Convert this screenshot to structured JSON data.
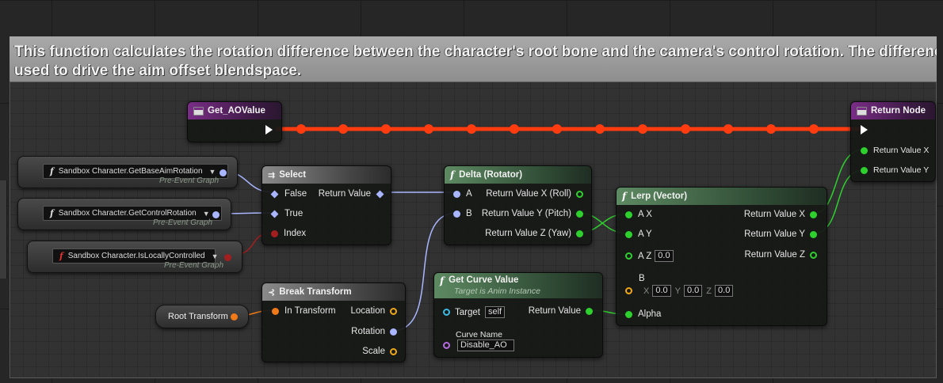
{
  "comment": {
    "line1": "This function calculates the rotation difference between the character's root bone and the camera's control rotation. The difference is",
    "line2": "used to drive the aim offset blendspace."
  },
  "nodes": {
    "get_ao": {
      "title": "Get_AOValue"
    },
    "return_node": {
      "title": "Return Node",
      "pins": [
        "Return Value X",
        "Return Value Y"
      ]
    },
    "select": {
      "title": "Select",
      "pins": {
        "false": "False",
        "true": "True",
        "index": "Index",
        "return": "Return Value"
      }
    },
    "delta": {
      "title": "Delta (Rotator)",
      "pins": {
        "a": "A",
        "b": "B",
        "roll": "Return Value X (Roll)",
        "pitch": "Return Value Y (Pitch)",
        "yaw": "Return Value Z (Yaw)"
      }
    },
    "lerp": {
      "title": "Lerp (Vector)",
      "pins": {
        "ax": "A X",
        "ay": "A Y",
        "az": "A Z",
        "az_value": "0.0",
        "b": "B",
        "alpha": "Alpha",
        "rx": "Return Value X",
        "ry": "Return Value Y",
        "rz": "Return Value Z"
      },
      "b_values": {
        "x_label": "X",
        "x": "0.0",
        "y_label": "Y",
        "y": "0.0",
        "z_label": "Z",
        "z": "0.0"
      }
    },
    "break_transform": {
      "title": "Break Transform",
      "pins": {
        "in": "In Transform",
        "location": "Location",
        "rotation": "Rotation",
        "scale": "Scale"
      }
    },
    "get_curve": {
      "title": "Get Curve Value",
      "subtitle": "Target is Anim Instance",
      "pins": {
        "target": "Target",
        "target_value": "self",
        "curve_name": "Curve Name",
        "curve_value": "Disable_AO",
        "return": "Return Value"
      }
    }
  },
  "variables": [
    {
      "label": "Sandbox Character.GetBaseAimRotation",
      "sub": "Pre-Event Graph"
    },
    {
      "label": "Sandbox Character.GetControlRotation",
      "sub": "Pre-Event Graph"
    },
    {
      "label": "Sandbox Character.IsLocallyControlled",
      "sub": "Pre-Event Graph"
    }
  ],
  "root_transform": {
    "label": "Root Transform"
  },
  "colors": {
    "exec_wire": "#ff3c10",
    "float_pin": "#2ed02e",
    "rotator_pin": "#a9b6ff",
    "bool_pin": "#a31e1e",
    "transform_pin": "#f07a18"
  }
}
